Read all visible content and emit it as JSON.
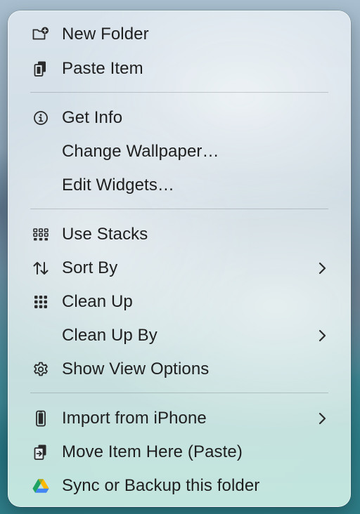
{
  "context_menu": {
    "items": [
      {
        "label": "New Folder",
        "icon": "new-folder-icon"
      },
      {
        "label": "Paste Item",
        "icon": "paste-icon"
      },
      {
        "label": "Get Info",
        "icon": "info-icon"
      },
      {
        "label": "Change Wallpaper…",
        "icon": ""
      },
      {
        "label": "Edit Widgets…",
        "icon": ""
      },
      {
        "label": "Use Stacks",
        "icon": "stacks-icon"
      },
      {
        "label": "Sort By",
        "icon": "sort-arrows-icon",
        "submenu": true
      },
      {
        "label": "Clean Up",
        "icon": "grid-dots-icon"
      },
      {
        "label": "Clean Up By",
        "icon": "",
        "submenu": true
      },
      {
        "label": "Show View Options",
        "icon": "gear-icon"
      },
      {
        "label": "Import from iPhone",
        "icon": "iphone-icon",
        "submenu": true
      },
      {
        "label": "Move Item Here (Paste)",
        "icon": "move-paste-icon"
      },
      {
        "label": "Sync or Backup this folder",
        "icon": "google-drive-icon"
      }
    ]
  },
  "colors": {
    "text": "#1e1e1e",
    "icon": "#2a2a2a",
    "separator": "rgba(0,0,0,0.16)",
    "drive_green": "#1ea362",
    "drive_blue": "#4285f4",
    "drive_yellow": "#ffba00"
  }
}
